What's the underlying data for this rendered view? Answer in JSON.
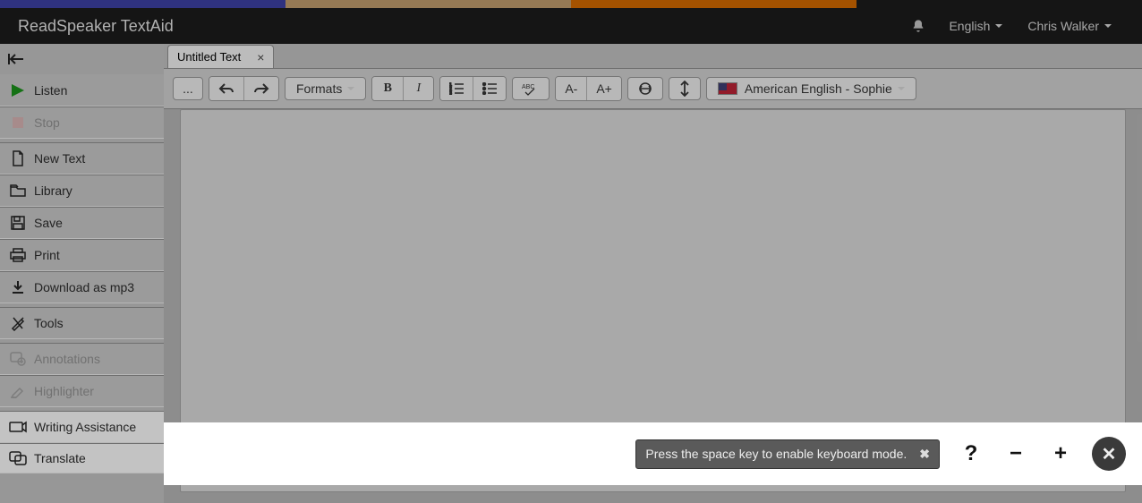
{
  "app": {
    "title": "ReadSpeaker TextAid"
  },
  "header": {
    "language": "English",
    "user": "Chris Walker"
  },
  "sidebar": [
    {
      "key": "listen",
      "label": "Listen",
      "disabled": false
    },
    {
      "key": "stop",
      "label": "Stop",
      "disabled": true
    },
    {
      "key": "newtext",
      "label": "New Text",
      "disabled": false
    },
    {
      "key": "library",
      "label": "Library",
      "disabled": false
    },
    {
      "key": "save",
      "label": "Save",
      "disabled": false
    },
    {
      "key": "print",
      "label": "Print",
      "disabled": false
    },
    {
      "key": "download",
      "label": "Download as mp3",
      "disabled": false
    },
    {
      "key": "tools",
      "label": "Tools",
      "disabled": false
    },
    {
      "key": "annotations",
      "label": "Annotations",
      "disabled": true
    },
    {
      "key": "highlighter",
      "label": "Highlighter",
      "disabled": true
    },
    {
      "key": "writing",
      "label": "Writing Assistance",
      "disabled": false,
      "selected": true
    },
    {
      "key": "translate",
      "label": "Translate",
      "disabled": false
    }
  ],
  "tab": {
    "title": "Untitled Text"
  },
  "toolbar": {
    "more": "...",
    "formats_label": "Formats",
    "font_decrease": "A-",
    "font_increase": "A+",
    "voice_label": "American English - Sophie"
  },
  "bottom": {
    "tooltip": "Press the space key to enable keyboard mode.",
    "help": "?",
    "minus": "−",
    "plus": "+",
    "close": "✕"
  }
}
